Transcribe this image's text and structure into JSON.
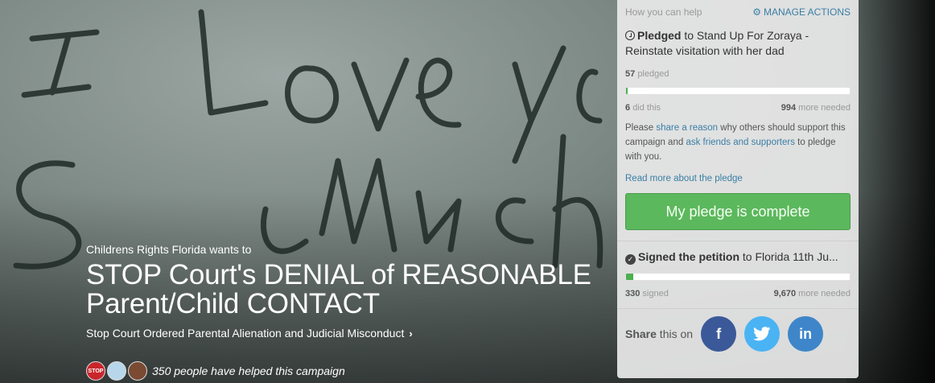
{
  "campaign": {
    "org_line": "Childrens Rights Florida wants to",
    "title_line1": "STOP Court's DENIAL of REASONABLE",
    "title_line2": "Parent/Child CONTACT",
    "subtitle": "Stop Court Ordered Parental Alienation and Judicial Misconduct",
    "helpers_text": "350 people have helped this campaign",
    "stop_badge": "STOP"
  },
  "panel": {
    "header": "How you can help",
    "manage_actions": "MANAGE ACTIONS",
    "pledge": {
      "strong": "Pledged",
      "title_rest": " to Stand Up For Zoraya - Reinstate visitation with her dad",
      "count": "57",
      "count_label": "pledged",
      "did": "6",
      "did_label": "did this",
      "needed": "994",
      "needed_label": "more needed",
      "progress": 0.006,
      "para_1": "Please ",
      "share_reason": "share a reason",
      "para_2": " why others should support this campaign and ",
      "ask_friends": "ask friends and supporters",
      "para_3": " to pledge with you.",
      "read_more": "Read more about the pledge",
      "complete_btn": "My pledge is complete"
    },
    "petition": {
      "strong": "Signed the petition",
      "title_rest": " to Florida 11th Ju...",
      "signed": "330",
      "signed_label": "signed",
      "needed": "9,670",
      "needed_label": "more needed",
      "progress": 0.033
    },
    "share": {
      "strong": "Share",
      "rest": " this on",
      "facebook": "f",
      "twitter": "t",
      "linkedin": "in"
    }
  },
  "colors": {
    "accent_link": "#3a7fa6",
    "progress_green": "#4caf50",
    "button_green": "#5cb85c",
    "facebook": "#3b5998",
    "twitter": "#4ab3f4",
    "linkedin": "#3e86c9"
  }
}
